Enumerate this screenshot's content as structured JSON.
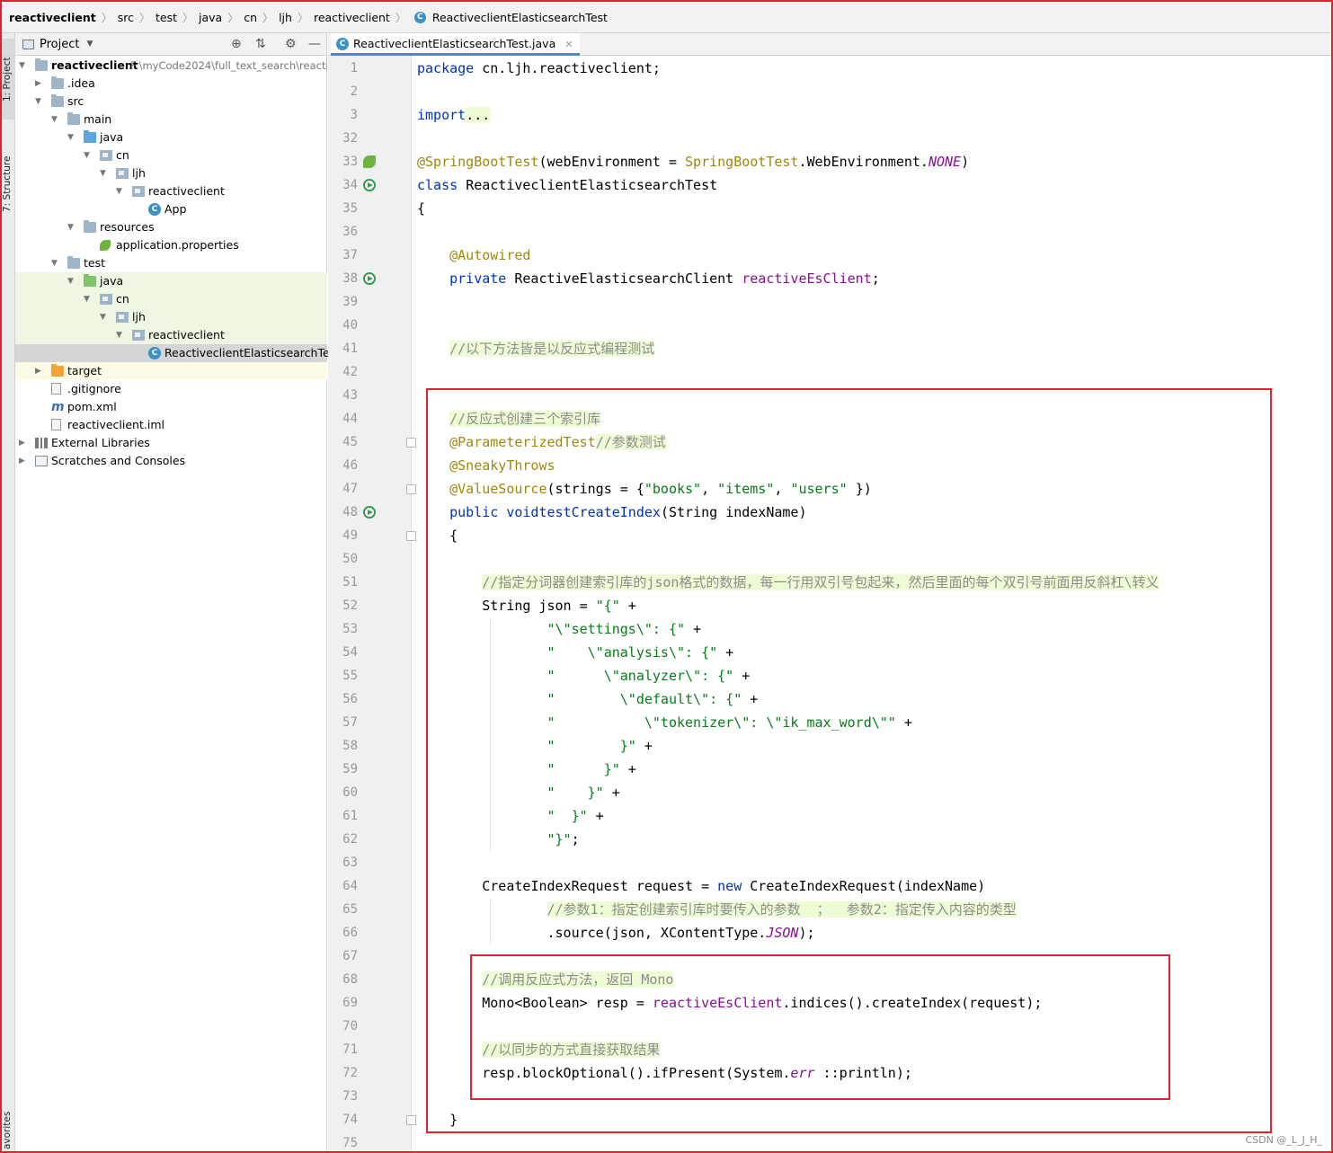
{
  "breadcrumb": [
    "reactiveclient",
    "src",
    "test",
    "java",
    "cn",
    "ljh",
    "reactiveclient",
    "ReactiveclientElasticsearchTest"
  ],
  "left_strip": {
    "project_tab": "1: Project",
    "structure_tab": "7: Structure",
    "favorites_tab": "avorites"
  },
  "project_panel": {
    "title": "Project",
    "tree": [
      {
        "label": "reactiveclient",
        "path": "F:\\myCode2024\\full_text_search\\reacti",
        "icon": "module-folder-icon",
        "expanded": true
      },
      {
        "label": ".idea",
        "icon": "folder-icon",
        "expanded": false
      },
      {
        "label": "src",
        "icon": "folder-icon",
        "expanded": true
      },
      {
        "label": "main",
        "icon": "folder-icon",
        "expanded": true
      },
      {
        "label": "java",
        "icon": "source-folder-icon",
        "expanded": true
      },
      {
        "label": "cn",
        "icon": "package-icon",
        "expanded": true
      },
      {
        "label": "ljh",
        "icon": "package-icon",
        "expanded": true
      },
      {
        "label": "reactiveclient",
        "icon": "package-icon",
        "expanded": true
      },
      {
        "label": "App",
        "icon": "class-icon"
      },
      {
        "label": "resources",
        "icon": "resources-folder-icon",
        "expanded": true
      },
      {
        "label": "application.properties",
        "icon": "spring-properties-icon"
      },
      {
        "label": "test",
        "icon": "folder-icon",
        "expanded": true
      },
      {
        "label": "java",
        "icon": "test-source-folder-icon",
        "expanded": true
      },
      {
        "label": "cn",
        "icon": "package-icon",
        "expanded": true
      },
      {
        "label": "ljh",
        "icon": "package-icon",
        "expanded": true
      },
      {
        "label": "reactiveclient",
        "icon": "package-icon",
        "expanded": true
      },
      {
        "label": "ReactiveclientElasticsearchTest",
        "icon": "class-icon"
      },
      {
        "label": "target",
        "icon": "excluded-folder-icon",
        "expanded": false
      },
      {
        "label": ".gitignore",
        "icon": "text-file-icon"
      },
      {
        "label": "pom.xml",
        "icon": "maven-icon"
      },
      {
        "label": "reactiveclient.iml",
        "icon": "iml-file-icon"
      },
      {
        "label": "External Libraries",
        "icon": "libraries-icon",
        "expanded": false
      },
      {
        "label": "Scratches and Consoles",
        "icon": "scratches-icon",
        "expanded": false
      }
    ]
  },
  "editor": {
    "tab_label": "ReactiveclientElasticsearchTest.java",
    "line_numbers": [
      "1",
      "2",
      "3",
      "32",
      "33",
      "34",
      "35",
      "36",
      "37",
      "38",
      "39",
      "40",
      "41",
      "42",
      "43",
      "44",
      "45",
      "46",
      "47",
      "48",
      "49",
      "50",
      "51",
      "52",
      "53",
      "54",
      "55",
      "56",
      "57",
      "58",
      "59",
      "60",
      "61",
      "62",
      "63",
      "64",
      "65",
      "66",
      "67",
      "68",
      "69",
      "70",
      "71",
      "72",
      "73",
      "74",
      "75"
    ],
    "lines": [
      [
        [
          "kw",
          "package"
        ],
        [
          "",
          "cn.ljh.reactiveclient;"
        ]
      ],
      [],
      [
        [
          "kw",
          "import"
        ],
        [
          "",
          ""
        ],
        [
          "hlf",
          "..."
        ]
      ],
      [],
      [
        [
          "an",
          "@SpringBootTest"
        ],
        [
          "",
          "(webEnvironment = "
        ],
        [
          "an",
          "SpringBootTest"
        ],
        [
          "",
          ".WebEnvironment."
        ],
        [
          "itfl",
          "NONE"
        ],
        [
          "",
          ")"
        ]
      ],
      [
        [
          "kw",
          "class"
        ],
        [
          "",
          "ReactiveclientElasticsearchTest"
        ]
      ],
      [
        [
          "",
          "{"
        ]
      ],
      [],
      [
        [
          "",
          "    "
        ],
        [
          "an",
          "@Autowired"
        ]
      ],
      [
        [
          "",
          "    "
        ],
        [
          "kw",
          "private"
        ],
        [
          "",
          "ReactiveElasticsearchClient "
        ],
        [
          "fl",
          "reactiveEsClient"
        ],
        [
          "",
          ";"
        ]
      ],
      [],
      [],
      [
        [
          "",
          "    "
        ],
        [
          "cmh",
          "//以下方法皆是以反应式编程测试"
        ]
      ],
      [],
      [],
      [
        [
          "",
          "    "
        ],
        [
          "cmh",
          "//反应式创建三个索引库"
        ]
      ],
      [
        [
          "",
          "    "
        ],
        [
          "an",
          "@ParameterizedTest"
        ],
        [
          "",
          ""
        ],
        [
          "cmh",
          "//参数测试"
        ]
      ],
      [
        [
          "",
          "    "
        ],
        [
          "an",
          "@SneakyThrows"
        ]
      ],
      [
        [
          "",
          "    "
        ],
        [
          "an",
          "@ValueSource"
        ],
        [
          "",
          "(strings = {"
        ],
        [
          "st",
          "\"books\""
        ],
        [
          "",
          ", "
        ],
        [
          "st",
          "\"items\""
        ],
        [
          "",
          ", "
        ],
        [
          "st",
          "\"users\""
        ],
        [
          "",
          "})"
        ]
      ],
      [
        [
          "",
          "    "
        ],
        [
          "kw",
          "public void"
        ],
        [
          "",
          ""
        ],
        [
          "kw",
          "testCreateIndex"
        ],
        [
          "",
          "(String indexName)"
        ]
      ],
      [
        [
          "",
          "    {"
        ]
      ],
      [],
      [
        [
          "",
          "        "
        ],
        [
          "cmh",
          "//指定分词器创建索引库的json格式的数据，每一行用双引号包起来，然后里面的每个双引号前面用反斜杠\\转义"
        ]
      ],
      [
        [
          "",
          "        String json = "
        ],
        [
          "st",
          "\"{\""
        ],
        [
          "",
          " +"
        ]
      ],
      [
        [
          "",
          "                "
        ],
        [
          "st",
          "\"\\\"settings\\\": {\""
        ],
        [
          "",
          " +"
        ]
      ],
      [
        [
          "",
          "                "
        ],
        [
          "st",
          "\"    \\\"analysis\\\": {\""
        ],
        [
          "",
          " +"
        ]
      ],
      [
        [
          "",
          "                "
        ],
        [
          "st",
          "\"      \\\"analyzer\\\": {\""
        ],
        [
          "",
          " +"
        ]
      ],
      [
        [
          "",
          "                "
        ],
        [
          "st",
          "\"        \\\"default\\\": {\""
        ],
        [
          "",
          " +"
        ]
      ],
      [
        [
          "",
          "                "
        ],
        [
          "st",
          "\"           \\\"tokenizer\\\": \\\"ik_max_word\\\"\""
        ],
        [
          "",
          " +"
        ]
      ],
      [
        [
          "",
          "                "
        ],
        [
          "st",
          "\"        }\""
        ],
        [
          "",
          " +"
        ]
      ],
      [
        [
          "",
          "                "
        ],
        [
          "st",
          "\"      }\""
        ],
        [
          "",
          " +"
        ]
      ],
      [
        [
          "",
          "                "
        ],
        [
          "st",
          "\"    }\""
        ],
        [
          "",
          " +"
        ]
      ],
      [
        [
          "",
          "                "
        ],
        [
          "st",
          "\"  }\""
        ],
        [
          "",
          " +"
        ]
      ],
      [
        [
          "",
          "                "
        ],
        [
          "st",
          "\"}\""
        ],
        [
          "",
          ";"
        ]
      ],
      [],
      [
        [
          "",
          "        CreateIndexRequest request = "
        ],
        [
          "kw",
          "new"
        ],
        [
          "",
          "CreateIndexRequest(indexName)"
        ]
      ],
      [
        [
          "",
          "                "
        ],
        [
          "cmh",
          "//参数1：指定创建索引库时要传入的参数  ；  参数2：指定传入内容的类型"
        ]
      ],
      [
        [
          "",
          "                .source(json, XContentType."
        ],
        [
          "itfl",
          "JSON"
        ],
        [
          "",
          ");"
        ]
      ],
      [],
      [
        [
          "",
          "        "
        ],
        [
          "cmh",
          "//调用反应式方法，返回 Mono"
        ]
      ],
      [
        [
          "",
          "        Mono<Boolean> resp = "
        ],
        [
          "fl",
          "reactiveEsClient"
        ],
        [
          "",
          ".indices().createIndex(request);"
        ]
      ],
      [],
      [
        [
          "",
          "        "
        ],
        [
          "cmh",
          "//以同步的方式直接获取结果"
        ]
      ],
      [
        [
          "",
          "        resp.blockOptional().ifPresent(System."
        ],
        [
          "itfl",
          "err"
        ],
        [
          "",
          "::println);"
        ]
      ],
      [],
      [
        [
          "",
          "    }"
        ]
      ],
      []
    ]
  },
  "watermark": "CSDN @_L_J_H_",
  "colors": {
    "accent": "#3d91c5",
    "keyword": "#0033b3",
    "annotation": "#9e880d",
    "string": "#067d17",
    "field": "#871094",
    "comment": "#8c8c8c",
    "highlight_box": "#e0242f"
  }
}
